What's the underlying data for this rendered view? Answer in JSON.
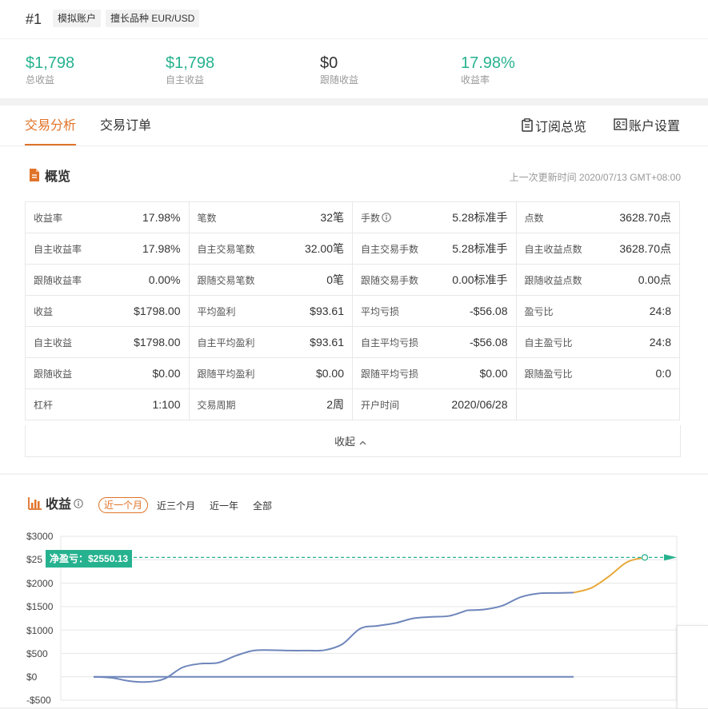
{
  "header": {
    "account_no": "#1",
    "tags": [
      "模拟账户",
      "擅长品种 EUR/USD"
    ]
  },
  "stats": [
    {
      "value": "$1,798",
      "label": "总收益",
      "color": "#26b28f"
    },
    {
      "value": "$1,798",
      "label": "自主收益",
      "color": "#26b28f"
    },
    {
      "value": "$0",
      "label": "跟随收益",
      "color": "#333333"
    },
    {
      "value": "17.98%",
      "label": "收益率",
      "color": "#26b28f"
    }
  ],
  "tabs": [
    {
      "label": "交易分析",
      "active": true
    },
    {
      "label": "交易订单",
      "active": false
    }
  ],
  "actions": {
    "subscribe": "订阅总览",
    "settings": "账户设置"
  },
  "overview": {
    "title": "概览",
    "updated": "上一次更新时间 2020/07/13 GMT+08:00",
    "rows": [
      [
        {
          "k": "收益率",
          "v": "17.98%"
        },
        {
          "k": "笔数",
          "v": "32笔"
        },
        {
          "k": "手数",
          "v": "5.28标准手",
          "info": true
        },
        {
          "k": "点数",
          "v": "3628.70点"
        }
      ],
      [
        {
          "k": "自主收益率",
          "v": "17.98%"
        },
        {
          "k": "自主交易笔数",
          "v": "32.00笔"
        },
        {
          "k": "自主交易手数",
          "v": "5.28标准手"
        },
        {
          "k": "自主收益点数",
          "v": "3628.70点"
        }
      ],
      [
        {
          "k": "跟随收益率",
          "v": "0.00%"
        },
        {
          "k": "跟随交易笔数",
          "v": "0笔"
        },
        {
          "k": "跟随交易手数",
          "v": "0.00标准手"
        },
        {
          "k": "跟随收益点数",
          "v": "0.00点"
        }
      ],
      [
        {
          "k": "收益",
          "v": "$1798.00"
        },
        {
          "k": "平均盈利",
          "v": "$93.61"
        },
        {
          "k": "平均亏损",
          "v": "-$56.08"
        },
        {
          "k": "盈亏比",
          "v": "24:8"
        }
      ],
      [
        {
          "k": "自主收益",
          "v": "$1798.00"
        },
        {
          "k": "自主平均盈利",
          "v": "$93.61"
        },
        {
          "k": "自主平均亏损",
          "v": "-$56.08"
        },
        {
          "k": "自主盈亏比",
          "v": "24:8"
        }
      ],
      [
        {
          "k": "跟随收益",
          "v": "$0.00"
        },
        {
          "k": "跟随平均盈利",
          "v": "$0.00"
        },
        {
          "k": "跟随平均亏损",
          "v": "$0.00"
        },
        {
          "k": "跟随盈亏比",
          "v": "0:0"
        }
      ],
      [
        {
          "k": "杠杆",
          "v": "1:100"
        },
        {
          "k": "交易周期",
          "v": "2周"
        },
        {
          "k": "开户时间",
          "v": "2020/06/28"
        },
        {
          "k": "",
          "v": ""
        }
      ]
    ],
    "collapse_label": "收起"
  },
  "earnings": {
    "title": "收益",
    "ranges": [
      {
        "label": "近一个月",
        "active": true
      },
      {
        "label": "近三个月",
        "active": false
      },
      {
        "label": "近一年",
        "active": false
      },
      {
        "label": "全部",
        "active": false
      }
    ]
  },
  "chart_data": {
    "type": "line",
    "yticks": [
      "$3000",
      "$25",
      "$2000",
      "$1500",
      "$1000",
      "$500",
      "$0",
      "-$500"
    ],
    "ylim": [
      -500,
      3000
    ],
    "net_label": "净盈亏：$2550.13",
    "net_value": 2550.13,
    "series": [
      {
        "color": "#6f86bb",
        "x": [
          0,
          2,
          4,
          6,
          8,
          10,
          12,
          14,
          16,
          18,
          20,
          22,
          24,
          26,
          28,
          30,
          32,
          34,
          36,
          38,
          40,
          42
        ],
        "values": [
          0,
          -20,
          -90,
          -110,
          -40,
          200,
          280,
          300,
          450,
          560,
          570,
          560,
          560,
          570,
          700,
          1030,
          1090,
          1150,
          1250,
          1280,
          1300,
          1420
        ]
      },
      {
        "color": "#6f86bb",
        "x": [
          42,
          44,
          46,
          48,
          50,
          52,
          54
        ],
        "values": [
          1420,
          1440,
          1520,
          1700,
          1780,
          1790,
          1798
        ]
      },
      {
        "color": "#e8a93a",
        "x": [
          54,
          56,
          58,
          60,
          62
        ],
        "values": [
          1798,
          1900,
          2150,
          2450,
          2550.13
        ]
      },
      {
        "color": "#6f86bb",
        "x": [
          0,
          54
        ],
        "values": [
          0,
          0
        ]
      }
    ],
    "grid": true
  }
}
